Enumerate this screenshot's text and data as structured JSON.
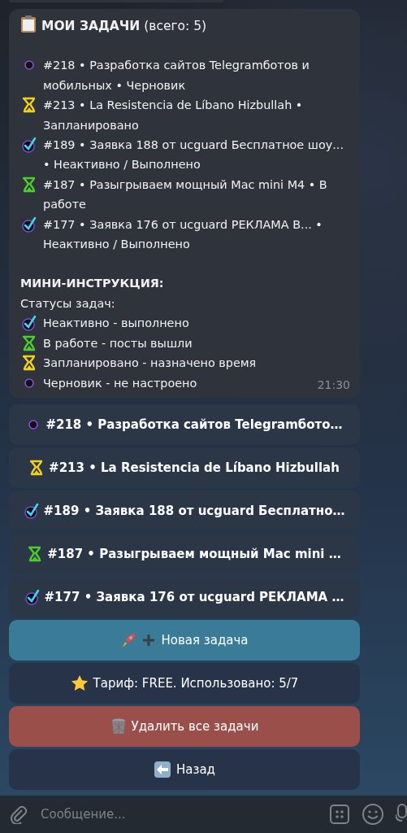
{
  "message": {
    "title": "**МОИ ЗАДАЧИ** (всего: 5)",
    "tasks": [
      {
        "kind": "draft",
        "text": "#218 • Разработка сайтов Telegramботов и мобильных • Черновик"
      },
      {
        "kind": "scheduled",
        "text": "#213 • La Resistencia de Líbano Hizbullah • Запланировано"
      },
      {
        "kind": "done",
        "text": "#189 • Заявка 188 от ucguard Бесплатное шоу... • Неактивно / Выполнено"
      },
      {
        "kind": "in_progress",
        "text": "#187 • Разыгрываем мощный Mac mini M4 • В работе"
      },
      {
        "kind": "done",
        "text": "#177 • Заявка 176 от ucguard РЕКЛАМА В... • Неактивно / Выполнено"
      }
    ],
    "instruction_heading": "МИНИ-ИНСТРУКЦИЯ:",
    "statuses_label": "Статусы задач:",
    "legend": [
      {
        "kind": "done",
        "text": "Неактивно - выполнено"
      },
      {
        "kind": "in_progress",
        "text": "В работе - посты вышли"
      },
      {
        "kind": "scheduled",
        "text": "Запланировано - назначено время"
      },
      {
        "kind": "draft",
        "text": "Черновик - не настроено"
      }
    ],
    "time": "21:30"
  },
  "task_buttons": [
    {
      "kind": "draft",
      "label": "#218 • Разработка сайтов Telegramбото…"
    },
    {
      "kind": "scheduled",
      "label": "#213 • La Resistencia de Líbano Hizbullah"
    },
    {
      "kind": "done",
      "label": "#189 • Заявка 188 от ucguard Бесплатно…"
    },
    {
      "kind": "in_progress",
      "label": "#187 • Разыгрываем мощный Mac mini …"
    },
    {
      "kind": "done",
      "label": "#177 • Заявка 176 от ucguard РЕКЛАМА …"
    }
  ],
  "action_buttons": [
    {
      "kind": "new",
      "label": "Новая задача"
    },
    {
      "kind": "tariff",
      "label": "Тариф: FREE. Использовано: 5/7"
    },
    {
      "kind": "delete",
      "label": "Удалить все задачи"
    },
    {
      "kind": "back",
      "label": "Назад"
    }
  ],
  "composer": {
    "placeholder": "Сообщение..."
  }
}
